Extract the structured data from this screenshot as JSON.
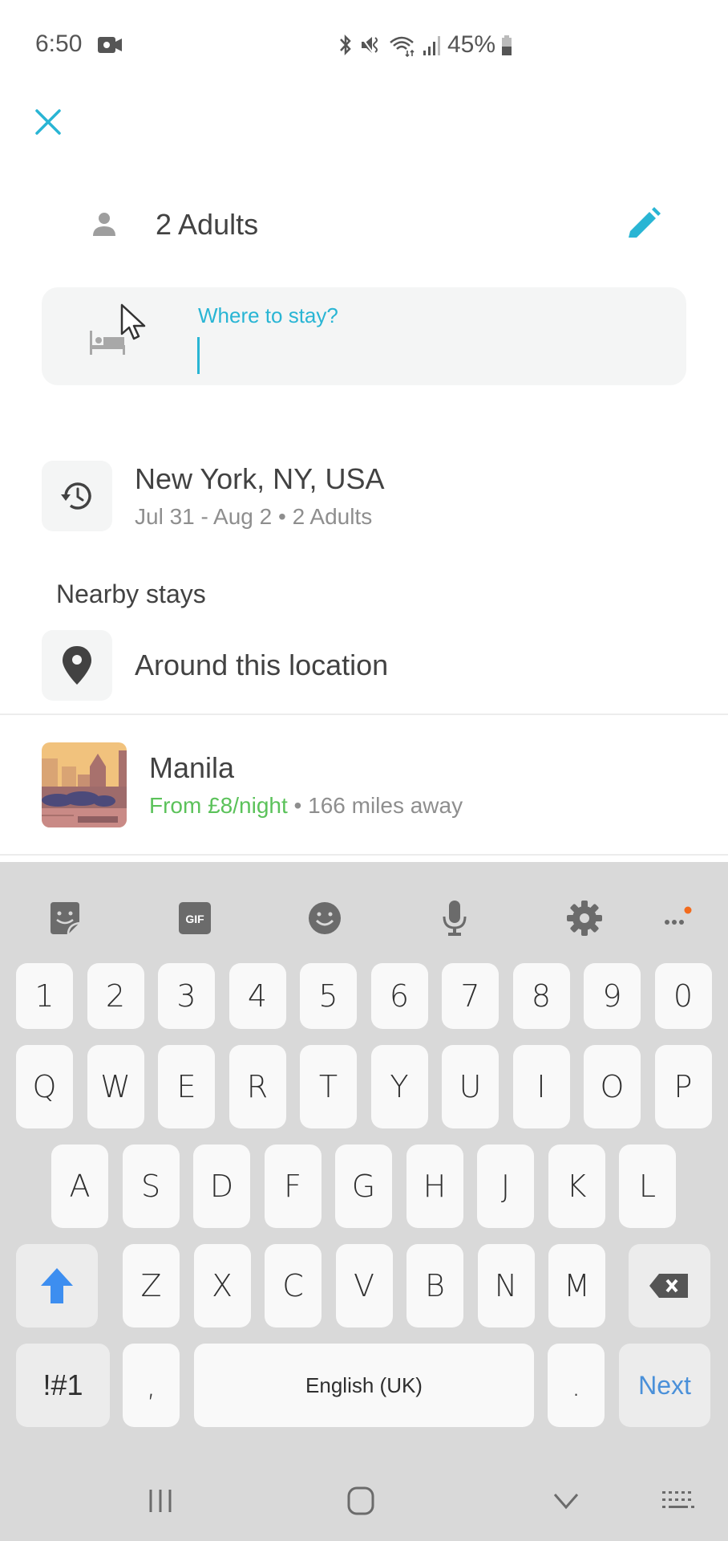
{
  "status_bar": {
    "time": "6:50",
    "battery": "45%",
    "icons": [
      "video-record-icon",
      "bluetooth-icon",
      "mute-vibrate-icon",
      "wifi-icon",
      "signal-icon",
      "battery-icon"
    ]
  },
  "header": {
    "close_icon": "close-icon"
  },
  "guests": {
    "label": "2 Adults",
    "icon": "person-icon",
    "edit_icon": "pencil-icon"
  },
  "search": {
    "label": "Where to stay?",
    "value": "",
    "icon": "bed-icon"
  },
  "recent": {
    "title": "New York, NY, USA",
    "subtitle": "Jul 31 - Aug 2 • 2 Adults",
    "icon": "history-icon"
  },
  "nearby": {
    "section_label": "Nearby stays",
    "around_label": "Around this location",
    "icon": "location-pin-icon"
  },
  "suggestion": {
    "city": "Manila",
    "price": "From £8/night",
    "separator": "•",
    "distance": "166 miles away"
  },
  "colors": {
    "accent": "#29b5d4",
    "price_green": "#5bc25a",
    "keyboard_bg": "#d9d9d9",
    "next_blue": "#4a90d9"
  },
  "keyboard": {
    "toolbar": [
      "sticker-icon",
      "gif-icon",
      "emoji-icon",
      "microphone-icon",
      "settings-gear-icon",
      "more-options-icon"
    ],
    "gif_label": "GIF",
    "row_numbers": [
      "1",
      "2",
      "3",
      "4",
      "5",
      "6",
      "7",
      "8",
      "9",
      "0"
    ],
    "row_1": [
      "Q",
      "W",
      "E",
      "R",
      "T",
      "Y",
      "U",
      "I",
      "O",
      "P"
    ],
    "row_2": [
      "A",
      "S",
      "D",
      "F",
      "G",
      "H",
      "J",
      "K",
      "L"
    ],
    "row_3": [
      "Z",
      "X",
      "C",
      "V",
      "B",
      "N",
      "M"
    ],
    "symbols_label": "!#1",
    "comma": ",",
    "space_label": "English (UK)",
    "period": ".",
    "action_label": "Next"
  },
  "navbar": {
    "icons": [
      "recent-apps-icon",
      "home-icon",
      "back-icon",
      "keyboard-switch-icon"
    ]
  }
}
